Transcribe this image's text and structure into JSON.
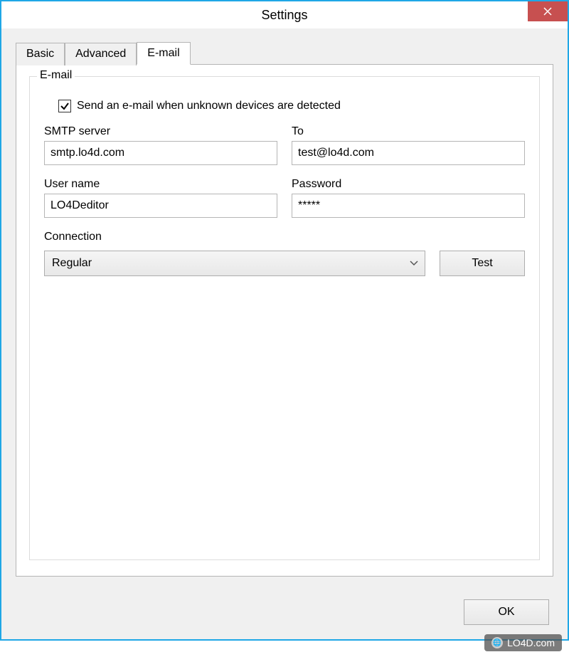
{
  "window": {
    "title": "Settings"
  },
  "tabs": {
    "basic": "Basic",
    "advanced": "Advanced",
    "email": "E-mail"
  },
  "group": {
    "label": "E-mail"
  },
  "checkbox": {
    "label": "Send an e-mail when unknown devices are detected",
    "checked": true
  },
  "fields": {
    "smtp": {
      "label": "SMTP server",
      "value": "smtp.lo4d.com"
    },
    "to": {
      "label": "To",
      "value": "test@lo4d.com"
    },
    "username": {
      "label": "User name",
      "value": "LO4Deditor"
    },
    "password": {
      "label": "Password",
      "value": "*****"
    },
    "connection": {
      "label": "Connection",
      "value": "Regular"
    }
  },
  "buttons": {
    "test": "Test",
    "ok": "OK"
  },
  "watermark": "LO4D.com"
}
